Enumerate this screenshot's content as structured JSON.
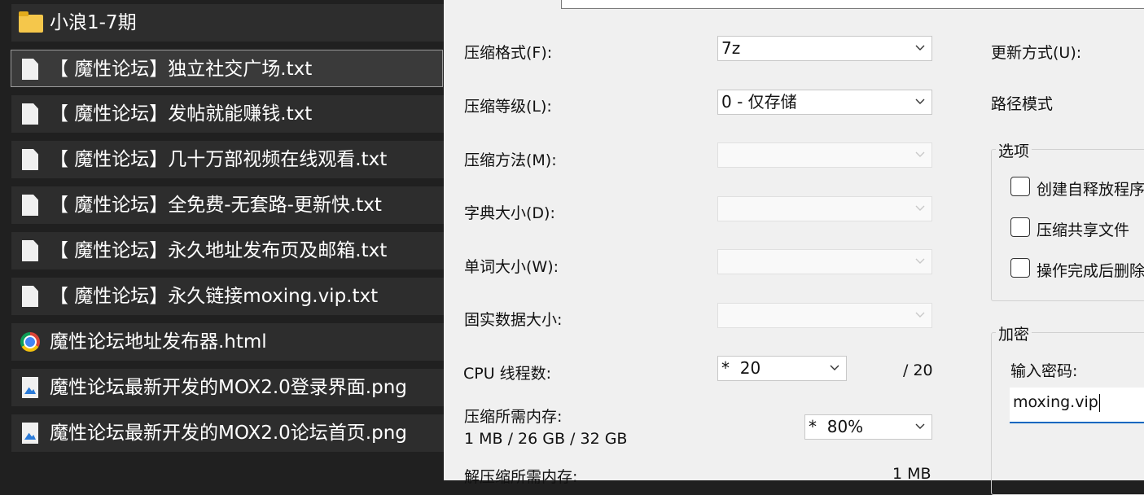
{
  "file_list": {
    "items": [
      {
        "name": "小浪1-7期",
        "icon": "folder-icon",
        "selected": false
      },
      {
        "name": "【 魔性论坛】独立社交广场.txt",
        "icon": "text-file-icon",
        "selected": true
      },
      {
        "name": "【 魔性论坛】发帖就能赚钱.txt",
        "icon": "text-file-icon",
        "selected": false
      },
      {
        "name": "【 魔性论坛】几十万部视频在线观看.txt",
        "icon": "text-file-icon",
        "selected": false
      },
      {
        "name": "【 魔性论坛】全免费-无套路-更新快.txt",
        "icon": "text-file-icon",
        "selected": false
      },
      {
        "name": "【 魔性论坛】永久地址发布页及邮箱.txt",
        "icon": "text-file-icon",
        "selected": false
      },
      {
        "name": "【 魔性论坛】永久链接moxing.vip.txt",
        "icon": "text-file-icon",
        "selected": false
      },
      {
        "name": "魔性论坛地址发布器.html",
        "icon": "chrome-html-icon",
        "selected": false
      },
      {
        "name": "魔性论坛最新开发的MOX2.0登录界面.png",
        "icon": "image-file-icon",
        "selected": false
      },
      {
        "name": "魔性论坛最新开发的MOX2.0论坛首页.png",
        "icon": "image-file-icon",
        "selected": false
      }
    ]
  },
  "dialog": {
    "format_label": "压缩格式(F):",
    "format_value": "7z",
    "level_label": "压缩等级(L):",
    "level_value": "0 - 仅存储",
    "method_label": "压缩方法(M):",
    "method_value": "",
    "dict_label": "字典大小(D):",
    "dict_value": "",
    "word_label": "单词大小(W):",
    "word_value": "",
    "solid_label": "固实数据大小:",
    "solid_value": "",
    "cpu_label": "CPU 线程数:",
    "cpu_value": "*  20",
    "cpu_max": "/ 20",
    "mem_comp_label": "压缩所需内存:",
    "mem_comp_value": "1 MB / 26 GB / 32 GB",
    "mem_percent_value": "*  80%",
    "mem_decomp_label": "解压缩所需内存:",
    "mem_decomp_value": "1 MB",
    "update_label": "更新方式(U):",
    "path_label": "路径模式",
    "options_title": "选项",
    "opt_sfx": "创建自释放程序",
    "opt_shared": "压缩共享文件",
    "opt_delete": "操作完成后删除",
    "encrypt_title": "加密",
    "password_label": "输入密码:",
    "password_value": "moxing.vip"
  }
}
